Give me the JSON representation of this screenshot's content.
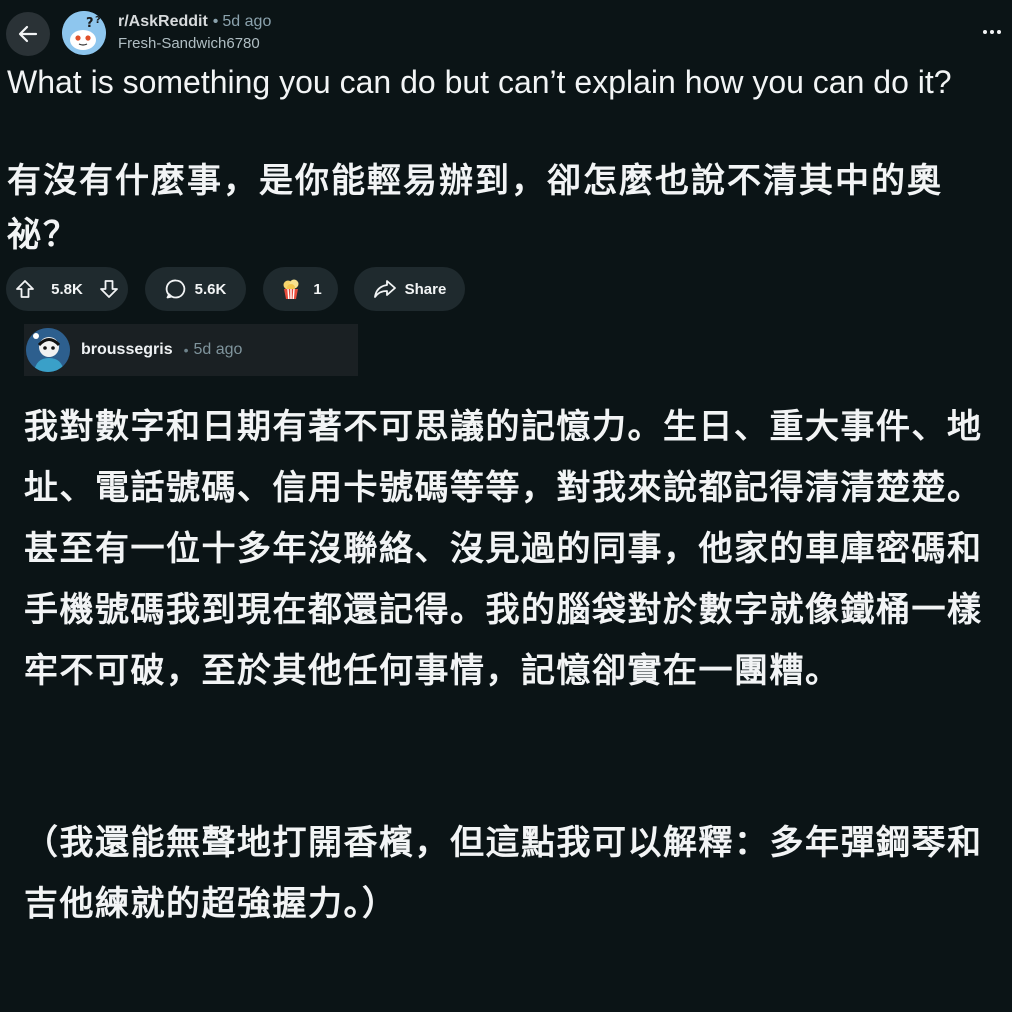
{
  "post": {
    "subreddit": "r/AskReddit",
    "separator": "•",
    "age": "5d ago",
    "author": "Fresh-Sandwich6780",
    "title_en": "What is something you can do but can’t explain how you can do it?",
    "title_zh": "有沒有什麼事，是你能輕易辦到，卻怎麼也說不清其中的奧祕？"
  },
  "actions": {
    "upvotes": "5.8K",
    "comments": "5.6K",
    "awards": "1",
    "share_label": "Share"
  },
  "comment": {
    "username": "broussegris",
    "separator": "•",
    "age": "5d ago",
    "paragraph1": "我對數字和日期有著不可思議的記憶力。生日、重大事件、地址、電話號碼、信用卡號碼等等，對我來說都記得清清楚楚。甚至有一位十多年沒聯絡、沒見過的同事，他家的車庫密碼和手機號碼我到現在都還記得。我的腦袋對於數字就像鐵桶一樣牢不可破，至於其他任何事情，記憶卻實在一團糟。",
    "paragraph2": "（我還能無聲地打開香檳，但這點我可以解釋：多年彈鋼琴和吉他練就的超強握力。）"
  },
  "icons": {
    "back": "arrow-left-icon",
    "more": "more-horizontal-icon",
    "upvote": "upvote-icon",
    "downvote": "downvote-icon",
    "comment": "comment-bubble-icon",
    "award": "award-icon",
    "share": "share-arrow-icon"
  },
  "colors": {
    "background": "#0b1416",
    "pill": "#1f2a2e",
    "muted_text": "#8ba2ad"
  }
}
